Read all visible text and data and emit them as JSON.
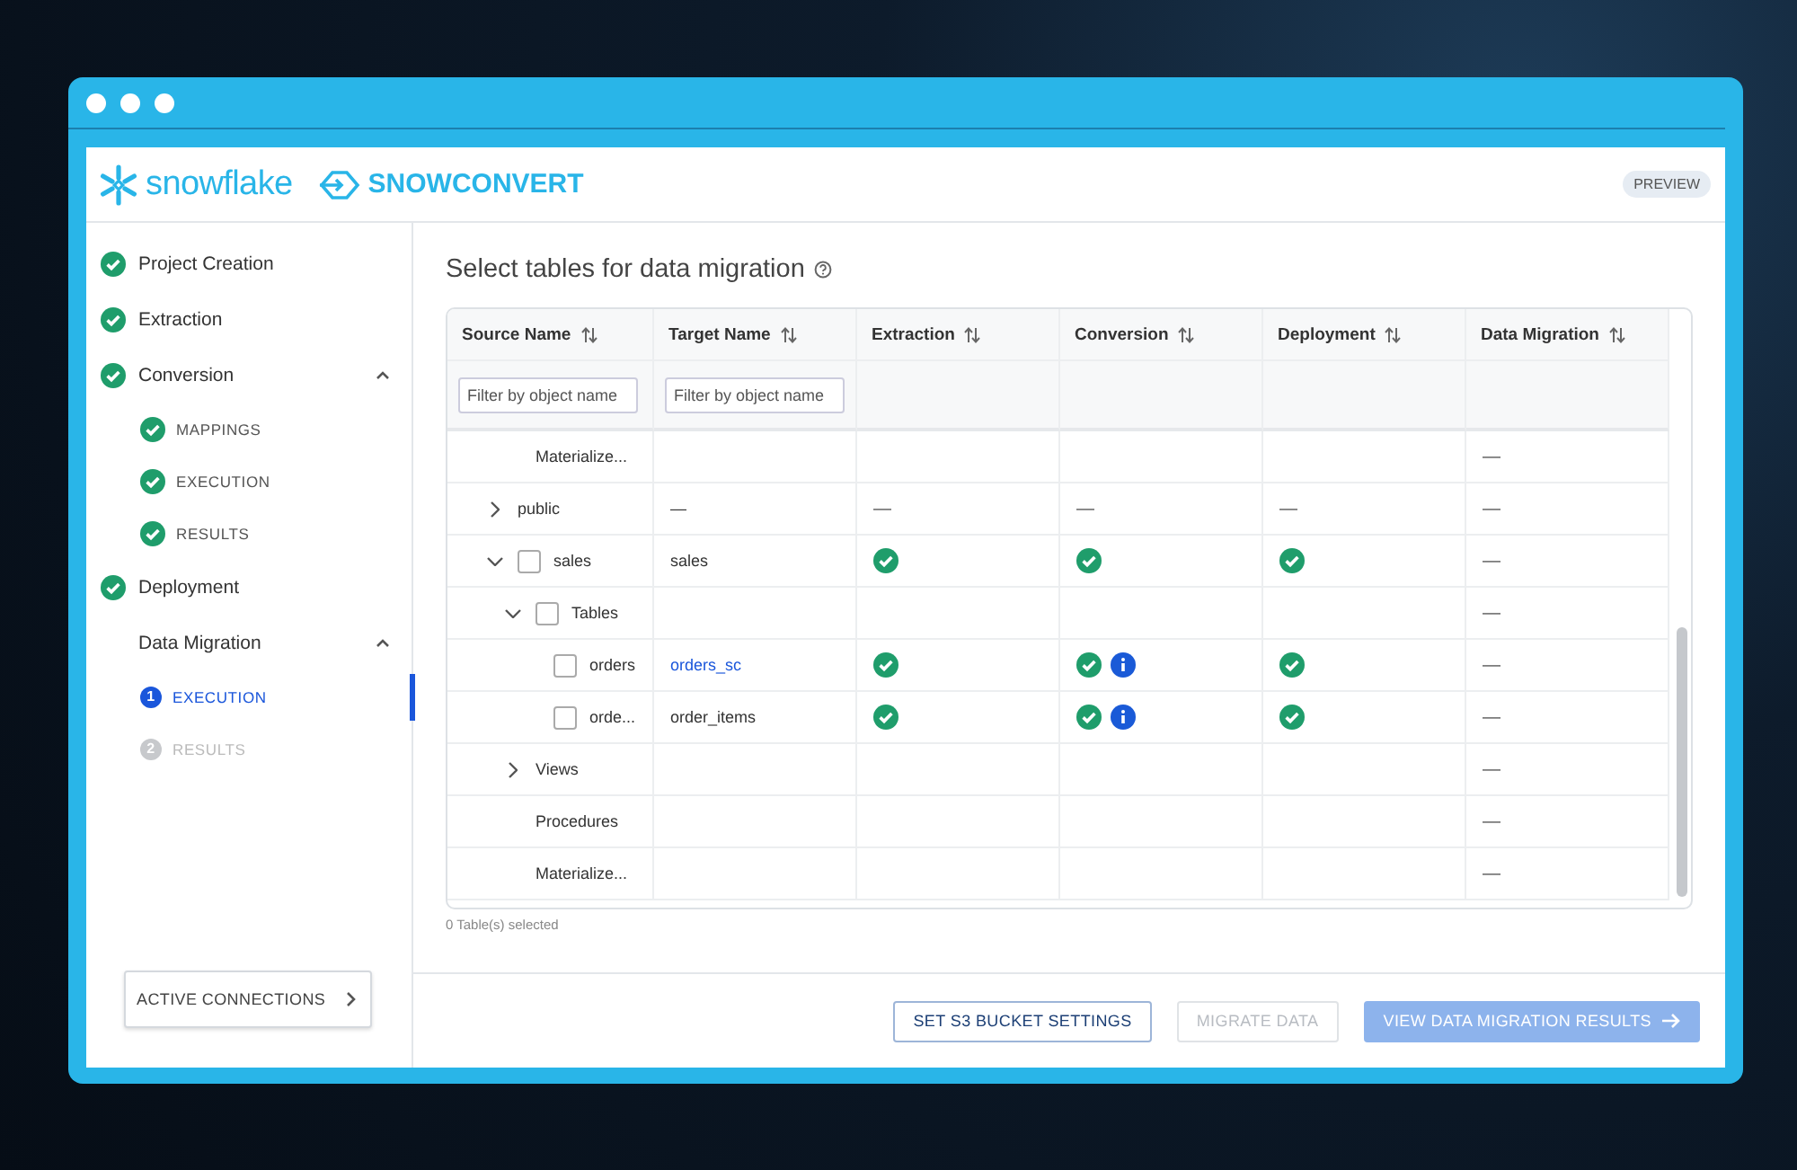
{
  "header": {
    "brand": "snowflake",
    "product": "SNOWCONVERT",
    "badge": "PREVIEW"
  },
  "sidebar": {
    "steps": [
      {
        "label": "Project Creation",
        "kind": "done"
      },
      {
        "label": "Extraction",
        "kind": "done"
      },
      {
        "label": "Conversion",
        "kind": "done",
        "expanded": true,
        "substeps": [
          {
            "label": "MAPPINGS",
            "kind": "done",
            "selected": false
          },
          {
            "label": "EXECUTION",
            "kind": "done",
            "selected": false
          },
          {
            "label": "RESULTS",
            "kind": "done",
            "selected": false
          }
        ]
      },
      {
        "label": "Deployment",
        "kind": "done"
      },
      {
        "label": "Data Migration",
        "expanded": true,
        "substeps": [
          {
            "label": "EXECUTION",
            "kind": "current",
            "number": "1",
            "selected": true
          },
          {
            "label": "RESULTS",
            "kind": "pending",
            "number": "2",
            "selected": false
          }
        ]
      }
    ],
    "connections_button": "ACTIVE CONNECTIONS"
  },
  "main": {
    "title": "Select tables for data migration",
    "table": {
      "columns": [
        "Source Name",
        "Target Name",
        "Extraction",
        "Conversion",
        "Deployment",
        "Data Migration"
      ],
      "filters": [
        {
          "placeholder": "Filter by object name"
        },
        {
          "placeholder": "Filter by object name"
        }
      ],
      "rows": [
        {
          "children": [
            {
              "name": "Materialize...",
              "data_migration": {
                "kind": "dash",
                "text": "—"
              }
            }
          ]
        },
        {
          "name": "public",
          "expanded": false,
          "target": "—",
          "target_link": false,
          "extraction": {
            "kind": "dash",
            "text": "—"
          },
          "conversion": {
            "kind": "dash",
            "text": "—"
          },
          "deployment": {
            "kind": "dash",
            "text": "—"
          },
          "data_migration": {
            "kind": "dash",
            "text": "—"
          }
        },
        {
          "name": "sales",
          "expanded": true,
          "checked": false,
          "target": "sales",
          "target_link": false,
          "extraction": {
            "kind": "check"
          },
          "conversion": {
            "kind": "check"
          },
          "deployment": {
            "kind": "check"
          },
          "data_migration": {
            "kind": "dash",
            "text": "—"
          },
          "children": [
            {
              "name": "Tables",
              "expanded": true,
              "checked": false,
              "data_migration": {
                "kind": "dash",
                "text": "—"
              },
              "children": [
                {
                  "name": "orders",
                  "checked": false,
                  "target": "orders_sc",
                  "target_link": true,
                  "extraction": {
                    "kind": "check"
                  },
                  "conversion": {
                    "kind": "check_info"
                  },
                  "deployment": {
                    "kind": "check"
                  },
                  "data_migration": {
                    "kind": "dash",
                    "text": "—"
                  }
                },
                {
                  "name": "orde...",
                  "checked": false,
                  "target": "order_items",
                  "target_link": false,
                  "extraction": {
                    "kind": "check"
                  },
                  "conversion": {
                    "kind": "check_info"
                  },
                  "deployment": {
                    "kind": "check"
                  },
                  "data_migration": {
                    "kind": "dash",
                    "text": "—"
                  }
                }
              ]
            },
            {
              "name": "Views",
              "expanded": false,
              "data_migration": {
                "kind": "dash",
                "text": "—"
              }
            },
            {
              "name": "Procedures",
              "data_migration": {
                "kind": "dash",
                "text": "—"
              }
            },
            {
              "name": "Materialize...",
              "data_migration": {
                "kind": "dash",
                "text": "—"
              }
            }
          ]
        }
      ]
    },
    "selection_count": "0 Table(s) selected",
    "buttons": [
      {
        "label": "SET S3 BUCKET SETTINGS",
        "kind": "outline",
        "disabled": false
      },
      {
        "label": "MIGRATE DATA",
        "kind": "outline",
        "disabled": true
      },
      {
        "label": "VIEW DATA MIGRATION RESULTS",
        "kind": "primary",
        "disabled": true
      }
    ]
  }
}
